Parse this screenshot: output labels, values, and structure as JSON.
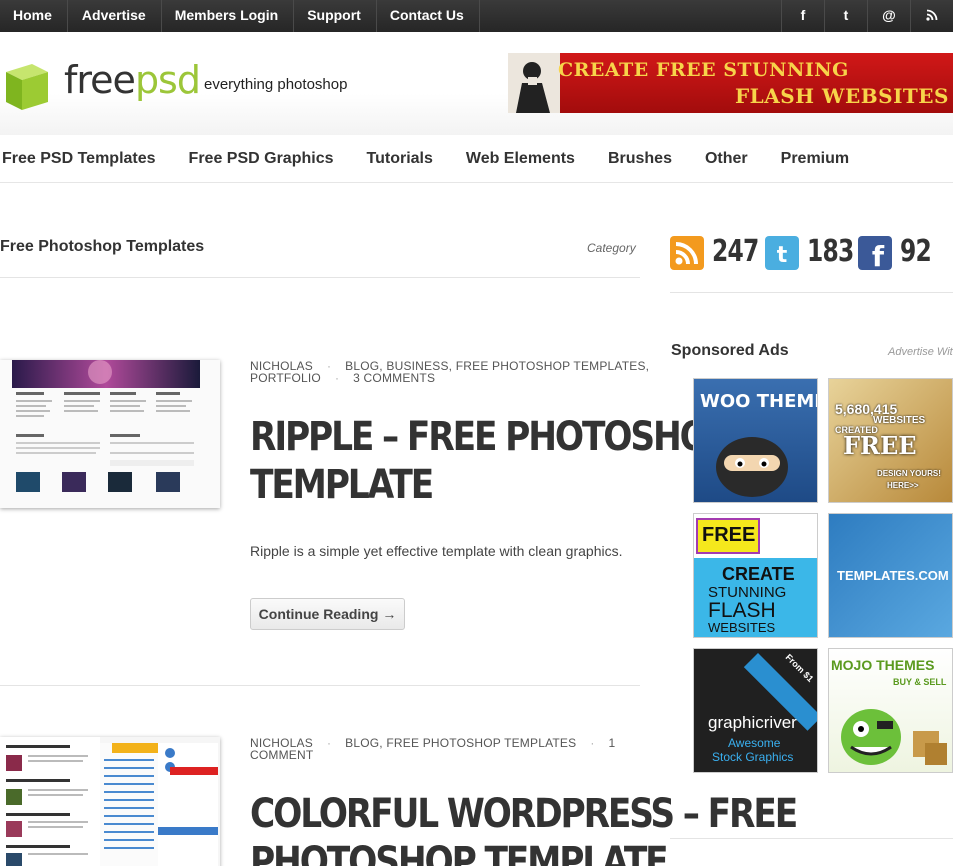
{
  "top_nav": [
    "Home",
    "Advertise",
    "Members Login",
    "Support",
    "Contact Us"
  ],
  "social_top": [
    {
      "icon": "facebook-icon",
      "glyph": "f"
    },
    {
      "icon": "twitter-icon",
      "glyph": "t"
    },
    {
      "icon": "email-icon",
      "glyph": "@"
    },
    {
      "icon": "rss-icon",
      "glyph": "\\"
    }
  ],
  "header": {
    "logo_free": "free",
    "logo_psd": "psd",
    "tagline": "everything photoshop",
    "banner_line1": "CREATE FREE STUNNING",
    "banner_line2": "FLASH WEBSITES"
  },
  "main_nav": [
    "Free PSD Templates",
    "Free PSD Graphics",
    "Tutorials",
    "Web Elements",
    "Brushes",
    "Other",
    "Premium"
  ],
  "content": {
    "category_title": "Free Photoshop Templates",
    "category_label": "Category"
  },
  "posts": [
    {
      "author": "NICHOLAS",
      "categories": "BLOG, BUSINESS, FREE PHOTOSHOP TEMPLATES,",
      "categories_line2": "PORTFOLIO",
      "comments": "3 COMMENTS",
      "title_line1": "RIPPLE – FREE PHOTOSHOP",
      "title_line2": "TEMPLATE",
      "excerpt": "Ripple is a simple yet effective template with clean graphics.",
      "button": "Continue Reading →"
    },
    {
      "author": "NICHOLAS",
      "categories": "BLOG, FREE PHOTOSHOP TEMPLATES",
      "comments_line1": "1",
      "comments_line2": "COMMENT",
      "title_line1": "COLORFUL WORDPRESS – FREE",
      "title_line2": "PHOTOSHOP TEMPLATE"
    }
  ],
  "sidebar": {
    "rss_count": "247",
    "twitter_count": "183",
    "facebook_count": "92",
    "sponsored_title": "Sponsored Ads",
    "sponsored_note": "Advertise Wit",
    "ads": {
      "woo": "WOO THEMES",
      "websites_line1": "5,680,415",
      "websites_line2": "WEBSITES",
      "websites_line3": "CREATED",
      "websites_line4": "FREE",
      "websites_line5": "DESIGN YOURS!",
      "websites_line6": "HERE>>",
      "flash_line1": "FREE",
      "flash_line2": "CREATE",
      "flash_line3": "STUNNING",
      "flash_line4": "FLASH",
      "flash_line5": "WEBSITES",
      "templates": "TEMPLATES.COM",
      "gr_name": "graphicriver",
      "gr_line1": "Awesome",
      "gr_line2": "Stock Graphics",
      "gr_ribbon": "From $1",
      "mojo_line1": "MOJO THEMES",
      "mojo_line2": "BUY & SELL"
    }
  },
  "colors": {
    "topbar": "#2c2c2c",
    "logo_green": "#9cc639",
    "banner_red": "#c41414",
    "banner_yellow": "#f7d44a",
    "rss": "#f39a1e",
    "twitter": "#4aaee0",
    "facebook": "#3b5998"
  }
}
